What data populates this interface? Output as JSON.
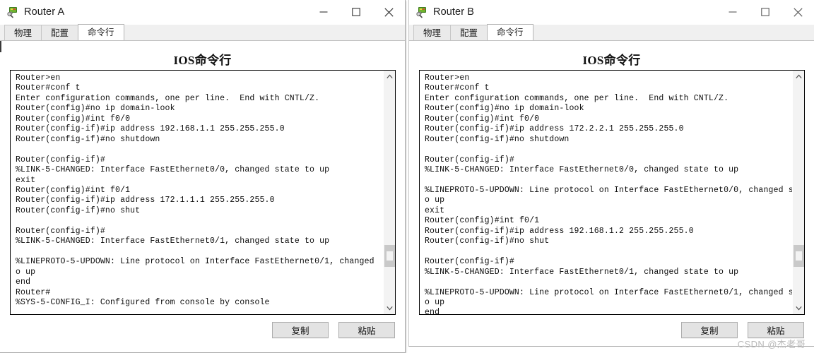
{
  "watermark": "CSDN @杰老哥",
  "windows": [
    {
      "title": "Router A",
      "icon": "router-device-icon",
      "controls": {
        "minimize": "minimize-icon",
        "maximize": "maximize-icon",
        "close": "close-icon"
      },
      "tabs": [
        {
          "label": "物理",
          "active": false
        },
        {
          "label": "配置",
          "active": false
        },
        {
          "label": "命令行",
          "active": true
        }
      ],
      "heading": "IOS命令行",
      "terminal": "Router>en\nRouter#conf t\nEnter configuration commands, one per line.  End with CNTL/Z.\nRouter(config)#no ip domain-look\nRouter(config)#int f0/0\nRouter(config-if)#ip address 192.168.1.1 255.255.255.0\nRouter(config-if)#no shutdown\n\nRouter(config-if)#\n%LINK-5-CHANGED: Interface FastEthernet0/0, changed state to up\nexit\nRouter(config)#int f0/1\nRouter(config-if)#ip address 172.1.1.1 255.255.255.0\nRouter(config-if)#no shut\n\nRouter(config-if)#\n%LINK-5-CHANGED: Interface FastEthernet0/1, changed state to up\n\n%LINEPROTO-5-UPDOWN: Line protocol on Interface FastEthernet0/1, changed\no up\nend\nRouter#\n%SYS-5-CONFIG_I: Configured from console by console",
      "scrollbar": {
        "thumb_top_pct": 74,
        "thumb_height_pct": 10
      },
      "buttons": [
        {
          "label": "复制",
          "name": "copy-button"
        },
        {
          "label": "粘贴",
          "name": "paste-button"
        }
      ]
    },
    {
      "title": "Router B",
      "icon": "router-device-icon",
      "controls": {
        "minimize": "minimize-icon",
        "maximize": "maximize-icon",
        "close": "close-icon"
      },
      "tabs": [
        {
          "label": "物理",
          "active": false
        },
        {
          "label": "配置",
          "active": false
        },
        {
          "label": "命令行",
          "active": true
        }
      ],
      "heading": "IOS命令行",
      "terminal": "Router>en\nRouter#conf t\nEnter configuration commands, one per line.  End with CNTL/Z.\nRouter(config)#no ip domain-look\nRouter(config)#int f0/0\nRouter(config-if)#ip address 172.2.2.1 255.255.255.0\nRouter(config-if)#no shutdown\n\nRouter(config-if)#\n%LINK-5-CHANGED: Interface FastEthernet0/0, changed state to up\n\n%LINEPROTO-5-UPDOWN: Line protocol on Interface FastEthernet0/0, changed st\no up\nexit\nRouter(config)#int f0/1\nRouter(config-if)#ip address 192.168.1.2 255.255.255.0\nRouter(config-if)#no shut\n\nRouter(config-if)#\n%LINK-5-CHANGED: Interface FastEthernet0/1, changed state to up\n\n%LINEPROTO-5-UPDOWN: Line protocol on Interface FastEthernet0/1, changed st\no up\nend",
      "scrollbar": {
        "thumb_top_pct": 74,
        "thumb_height_pct": 10
      },
      "buttons": [
        {
          "label": "复制",
          "name": "copy-button"
        },
        {
          "label": "粘贴",
          "name": "paste-button"
        }
      ]
    }
  ]
}
